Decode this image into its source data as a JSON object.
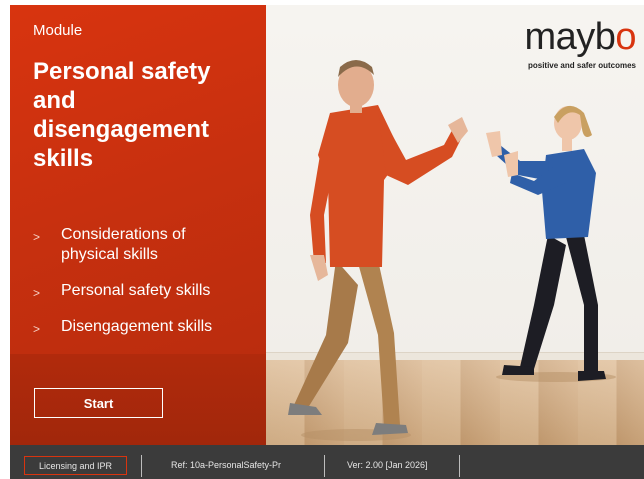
{
  "module": {
    "label": "Module",
    "title": "Personal safety and disengagement skills"
  },
  "topics": [
    {
      "label": "Considerations of physical skills"
    },
    {
      "label": "Personal safety skills"
    },
    {
      "label": "Disengagement skills"
    }
  ],
  "start_label": "Start",
  "brand": {
    "logo_main": "mayb",
    "logo_o": "o",
    "tagline": "positive and safer outcomes"
  },
  "footer": {
    "licensing_label": "Licensing and IPR",
    "ref": "Ref: 10a-PersonalSafety-Pr",
    "version": "Ver: 2.00 [Jan 2026]"
  },
  "colors": {
    "accent": "#d8340f",
    "footer_bg": "#3b3b3b"
  },
  "icons": {
    "topic_bullet": "chevron-right-icon"
  }
}
